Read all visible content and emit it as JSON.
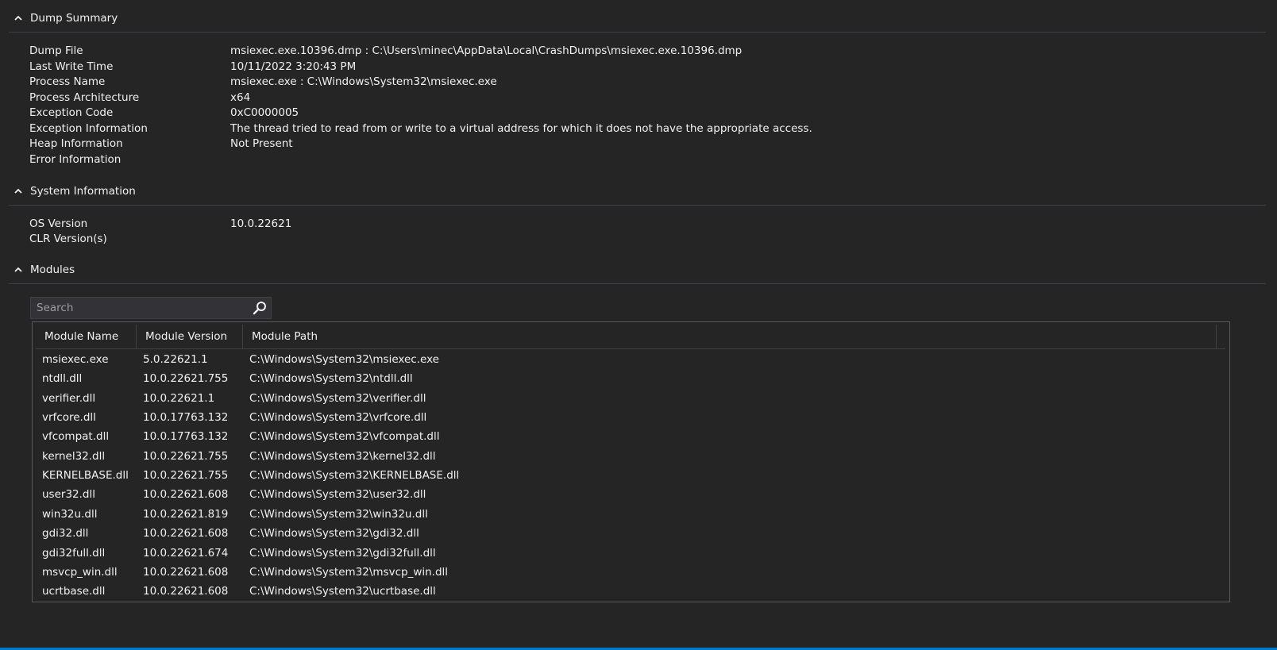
{
  "dump_summary": {
    "title": "Dump Summary",
    "rows": [
      {
        "key": "Dump File",
        "value": "msiexec.exe.10396.dmp : C:\\Users\\minec\\AppData\\Local\\CrashDumps\\msiexec.exe.10396.dmp"
      },
      {
        "key": "Last Write Time",
        "value": "10/11/2022 3:20:43 PM"
      },
      {
        "key": "Process Name",
        "value": "msiexec.exe : C:\\Windows\\System32\\msiexec.exe"
      },
      {
        "key": "Process Architecture",
        "value": "x64"
      },
      {
        "key": "Exception Code",
        "value": "0xC0000005"
      },
      {
        "key": "Exception Information",
        "value": "The thread tried to read from or write to a virtual address for which it does not have the appropriate access."
      },
      {
        "key": "Heap Information",
        "value": "Not Present"
      },
      {
        "key": "Error Information",
        "value": ""
      }
    ]
  },
  "system_information": {
    "title": "System Information",
    "rows": [
      {
        "key": "OS Version",
        "value": "10.0.22621"
      },
      {
        "key": "CLR Version(s)",
        "value": ""
      }
    ]
  },
  "modules": {
    "title": "Modules",
    "search": {
      "placeholder": "Search",
      "value": ""
    },
    "columns": [
      "Module Name",
      "Module Version",
      "Module Path"
    ],
    "rows": [
      {
        "name": "msiexec.exe",
        "version": "5.0.22621.1",
        "path": "C:\\Windows\\System32\\msiexec.exe"
      },
      {
        "name": "ntdll.dll",
        "version": "10.0.22621.755",
        "path": "C:\\Windows\\System32\\ntdll.dll"
      },
      {
        "name": "verifier.dll",
        "version": "10.0.22621.1",
        "path": "C:\\Windows\\System32\\verifier.dll"
      },
      {
        "name": "vrfcore.dll",
        "version": "10.0.17763.132",
        "path": "C:\\Windows\\System32\\vrfcore.dll"
      },
      {
        "name": "vfcompat.dll",
        "version": "10.0.17763.132",
        "path": "C:\\Windows\\System32\\vfcompat.dll"
      },
      {
        "name": "kernel32.dll",
        "version": "10.0.22621.755",
        "path": "C:\\Windows\\System32\\kernel32.dll"
      },
      {
        "name": "KERNELBASE.dll",
        "version": "10.0.22621.755",
        "path": "C:\\Windows\\System32\\KERNELBASE.dll"
      },
      {
        "name": "user32.dll",
        "version": "10.0.22621.608",
        "path": "C:\\Windows\\System32\\user32.dll"
      },
      {
        "name": "win32u.dll",
        "version": "10.0.22621.819",
        "path": "C:\\Windows\\System32\\win32u.dll"
      },
      {
        "name": "gdi32.dll",
        "version": "10.0.22621.608",
        "path": "C:\\Windows\\System32\\gdi32.dll"
      },
      {
        "name": "gdi32full.dll",
        "version": "10.0.22621.674",
        "path": "C:\\Windows\\System32\\gdi32full.dll"
      },
      {
        "name": "msvcp_win.dll",
        "version": "10.0.22621.608",
        "path": "C:\\Windows\\System32\\msvcp_win.dll"
      },
      {
        "name": "ucrtbase.dll",
        "version": "10.0.22621.608",
        "path": "C:\\Windows\\System32\\ucrtbase.dll"
      }
    ]
  },
  "icons": {
    "collapse": "chevron-up-icon",
    "search": "search-icon"
  },
  "colors": {
    "background": "#252526",
    "text": "#f1f1f1",
    "accent": "#007acc",
    "divider": "#3f3f46"
  }
}
